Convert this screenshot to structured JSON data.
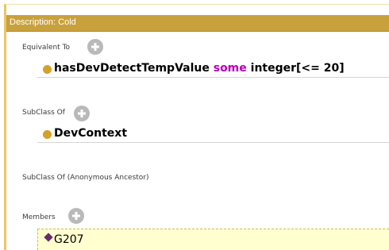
{
  "title": "Description: Cold",
  "sections": {
    "equivalent_to": {
      "label": "Equivalent To",
      "expression": {
        "property": "hasDevDetectTempValue",
        "keyword": "some",
        "filler": "integer[<= 20]"
      }
    },
    "subclass_of": {
      "label": "SubClass Of",
      "item": "DevContext"
    },
    "subclass_of_anon": {
      "label": "SubClass Of (Anonymous Ancestor)"
    },
    "members": {
      "label": "Members",
      "item": "G207"
    }
  },
  "colors": {
    "title_bar": "#c9a13c",
    "class_dot": "#d5a02a",
    "individual_diamond": "#6b2a6b",
    "keyword": "#b300b3",
    "selected_row": "#ffffd0"
  }
}
